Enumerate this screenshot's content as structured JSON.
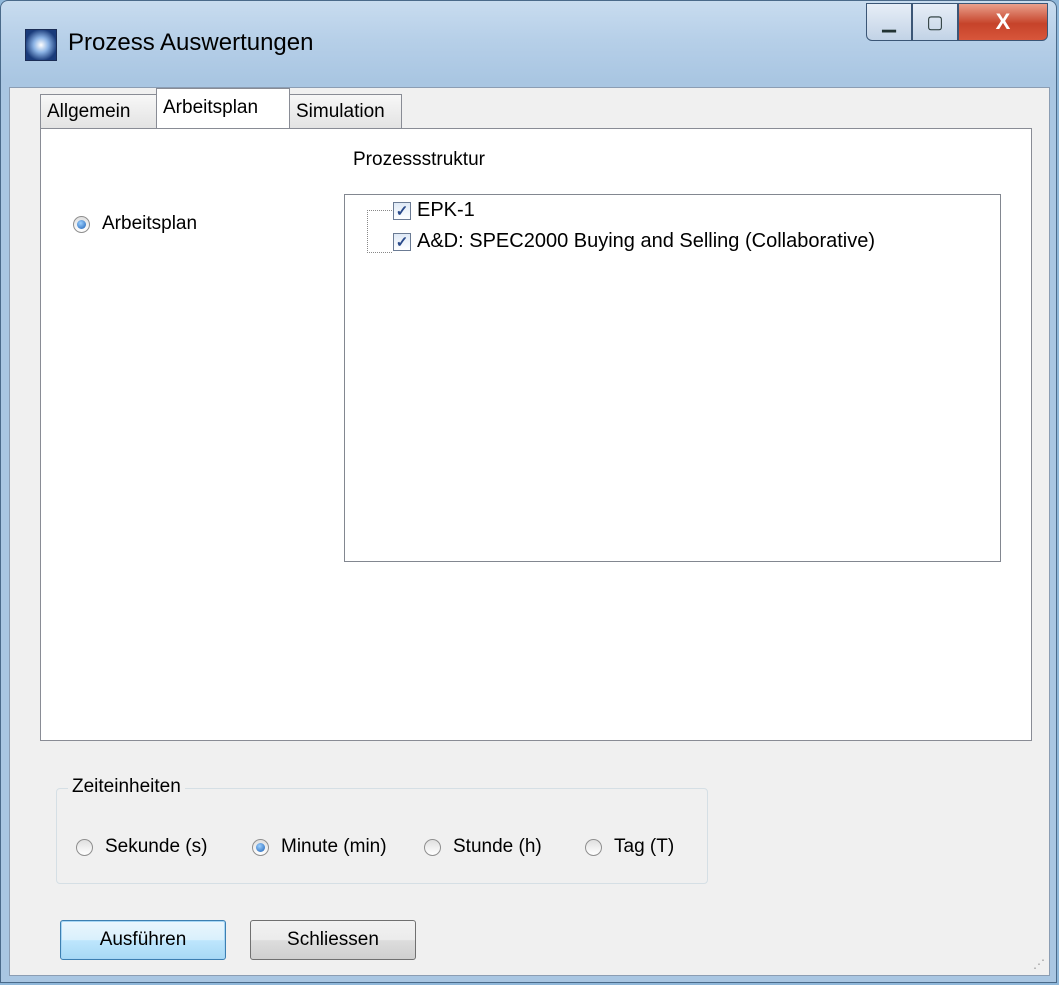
{
  "window": {
    "title": "Prozess Auswertungen",
    "close_glyph": "X"
  },
  "tabs": [
    {
      "label": "Allgemein",
      "active": false
    },
    {
      "label": "Arbeitsplan",
      "active": true
    },
    {
      "label": "Simulation",
      "active": false
    }
  ],
  "panel": {
    "radio_label": "Arbeitsplan",
    "radio_selected": true,
    "structure_label": "Prozessstruktur",
    "tree": [
      {
        "label": "EPK-1",
        "checked": true
      },
      {
        "label": "A&D: SPEC2000 Buying and Selling (Collaborative)",
        "checked": true
      }
    ]
  },
  "time_units": {
    "legend": "Zeiteinheiten",
    "options": [
      {
        "label": "Sekunde (s)",
        "selected": false
      },
      {
        "label": "Minute (min)",
        "selected": true
      },
      {
        "label": "Stunde (h)",
        "selected": false
      },
      {
        "label": "Tag (T)",
        "selected": false
      }
    ]
  },
  "buttons": {
    "run": "Ausführen",
    "close": "Schliessen"
  },
  "colors": {
    "accent": "#3c7fb1",
    "close_button": "#c6432a"
  }
}
